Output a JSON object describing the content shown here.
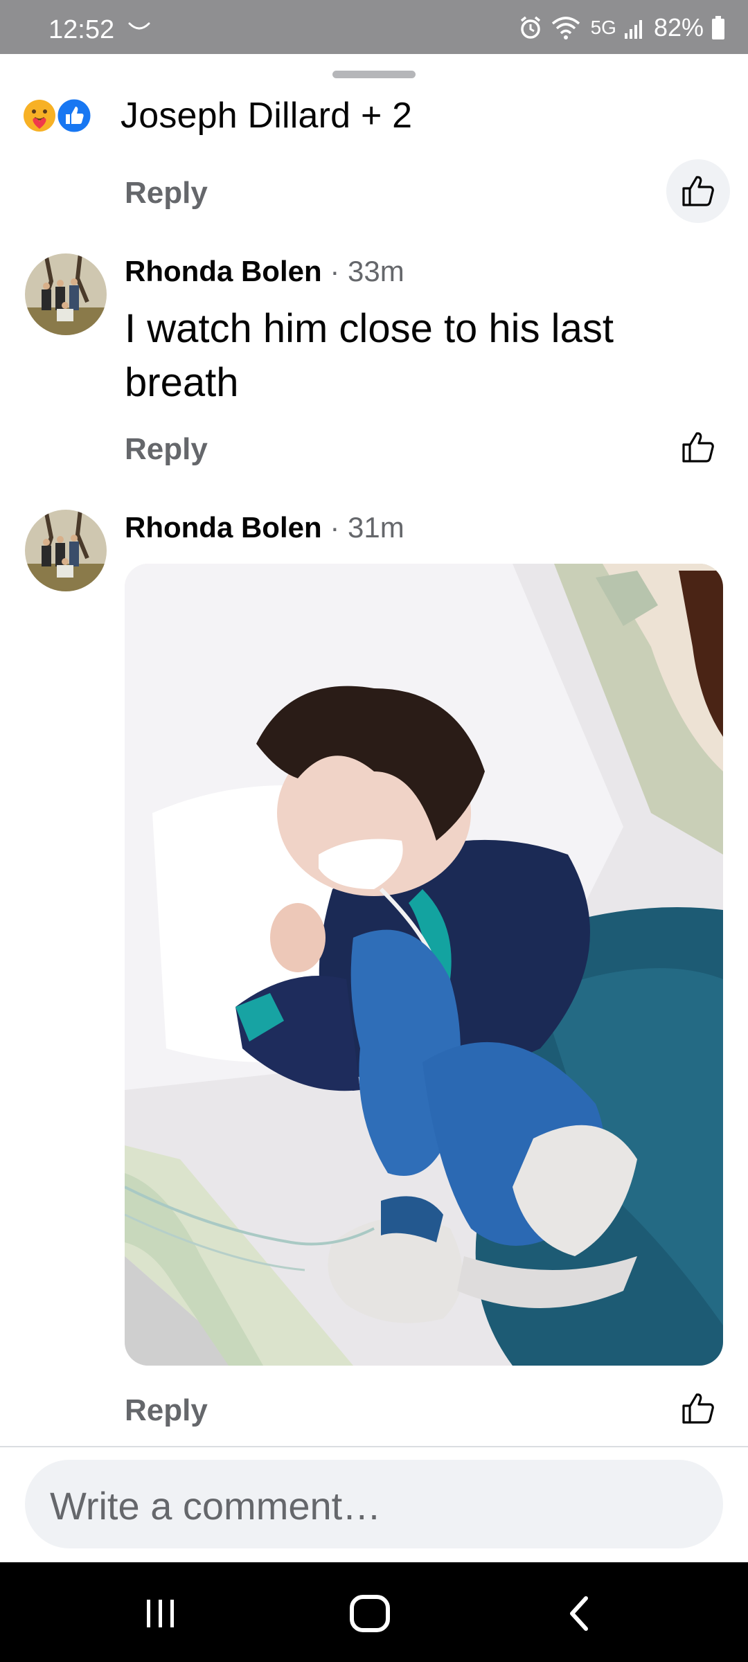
{
  "status_bar": {
    "time": "12:52",
    "network": "5G",
    "battery": "82%"
  },
  "reactions": {
    "names": "Joseph Dillard + 2",
    "icons": [
      "care-emoji",
      "like-reaction"
    ]
  },
  "comments": [
    {
      "reply_label": "Reply"
    },
    {
      "author": "Rhonda Bolen",
      "time": "· 33m",
      "text": "I watch him close to his last breath",
      "reply_label": "Reply"
    },
    {
      "author": "Rhonda Bolen",
      "time": "· 31m",
      "attachment": "photo",
      "reply_label": "Reply"
    }
  ],
  "composer": {
    "placeholder": "Write a comment…"
  },
  "nav": [
    "recent-apps",
    "home",
    "back"
  ],
  "colors": {
    "secondary_text": "#65676b",
    "like_blue": "#1877f2",
    "composer_bg": "#f0f2f5"
  }
}
